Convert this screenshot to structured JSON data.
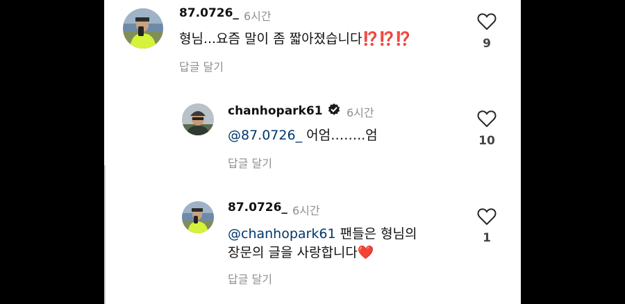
{
  "comments": [
    {
      "username": "87.0726_",
      "time": "6시간",
      "text": "형님...요즘 말이 좀 짧아졌습니다",
      "emphasis": "⁉️⁉️⁉️",
      "reply_label": "답글 달기",
      "likes": "9"
    },
    {
      "username": "chanhopark61",
      "verified": true,
      "time": "6시간",
      "mention": "@87.0726_",
      "text": " 어엄……..엄",
      "reply_label": "답글 달기",
      "likes": "10"
    },
    {
      "username": "87.0726_",
      "time": "6시간",
      "mention": "@chanhopark61",
      "text_line1": " 팬들은 형님의",
      "text_line2": "장문의 글을 사랑합니다",
      "emoji": "❤️",
      "reply_label": "답글 달기",
      "likes": "1"
    }
  ],
  "colors": {
    "background": "#000000",
    "panel": "#ffffff",
    "mention": "#00376b",
    "verified": "#1a1a1a",
    "secondary_text": "#8e8e8e"
  },
  "icons": [
    "heart-outline-icon",
    "verified-badge-icon"
  ]
}
